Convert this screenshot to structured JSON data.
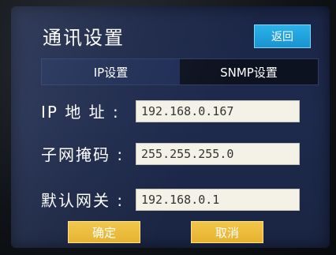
{
  "header": {
    "title": "通讯设置",
    "back_label": "返回"
  },
  "tabs": [
    {
      "label": "IP设置",
      "active": true
    },
    {
      "label": "SNMP设置",
      "active": false
    }
  ],
  "form": {
    "ip_label": "IP 地 址 :",
    "ip_value": "192.168.0.167",
    "mask_label": "子网掩码 :",
    "mask_value": "255.255.255.0",
    "gateway_label": "默认网关 :",
    "gateway_value": "192.168.0.1"
  },
  "actions": {
    "confirm_label": "确定",
    "cancel_label": "取消"
  },
  "colors": {
    "accent_blue": "#1a93cf",
    "button_yellow": "#e6b22e",
    "screen_bg": "#1e2a4d"
  }
}
